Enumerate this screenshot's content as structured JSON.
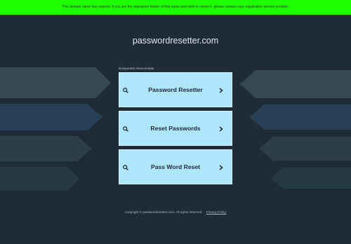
{
  "banner": {
    "message": "This domain name has expired. If you are the registered holder of this name and wish to renew it, please contact your registration service provider."
  },
  "header": {
    "domain": "passwordresetter.com"
  },
  "related": {
    "heading": "Búsquedas relacionadas",
    "items": [
      {
        "label": "Password Resetter"
      },
      {
        "label": "Reset Passwords"
      },
      {
        "label": "Pass Word Reset"
      }
    ]
  },
  "footer": {
    "copyright": "Copyright © passwordresetter.com.  All rights reserved.",
    "privacy_link": "Privacy Policy"
  },
  "colors": {
    "banner": "#1cff00",
    "background": "#1f2b37",
    "card": "#aee5ff"
  },
  "icons": {
    "card_left": "search-icon",
    "card_right": "chevron-right-icon"
  }
}
